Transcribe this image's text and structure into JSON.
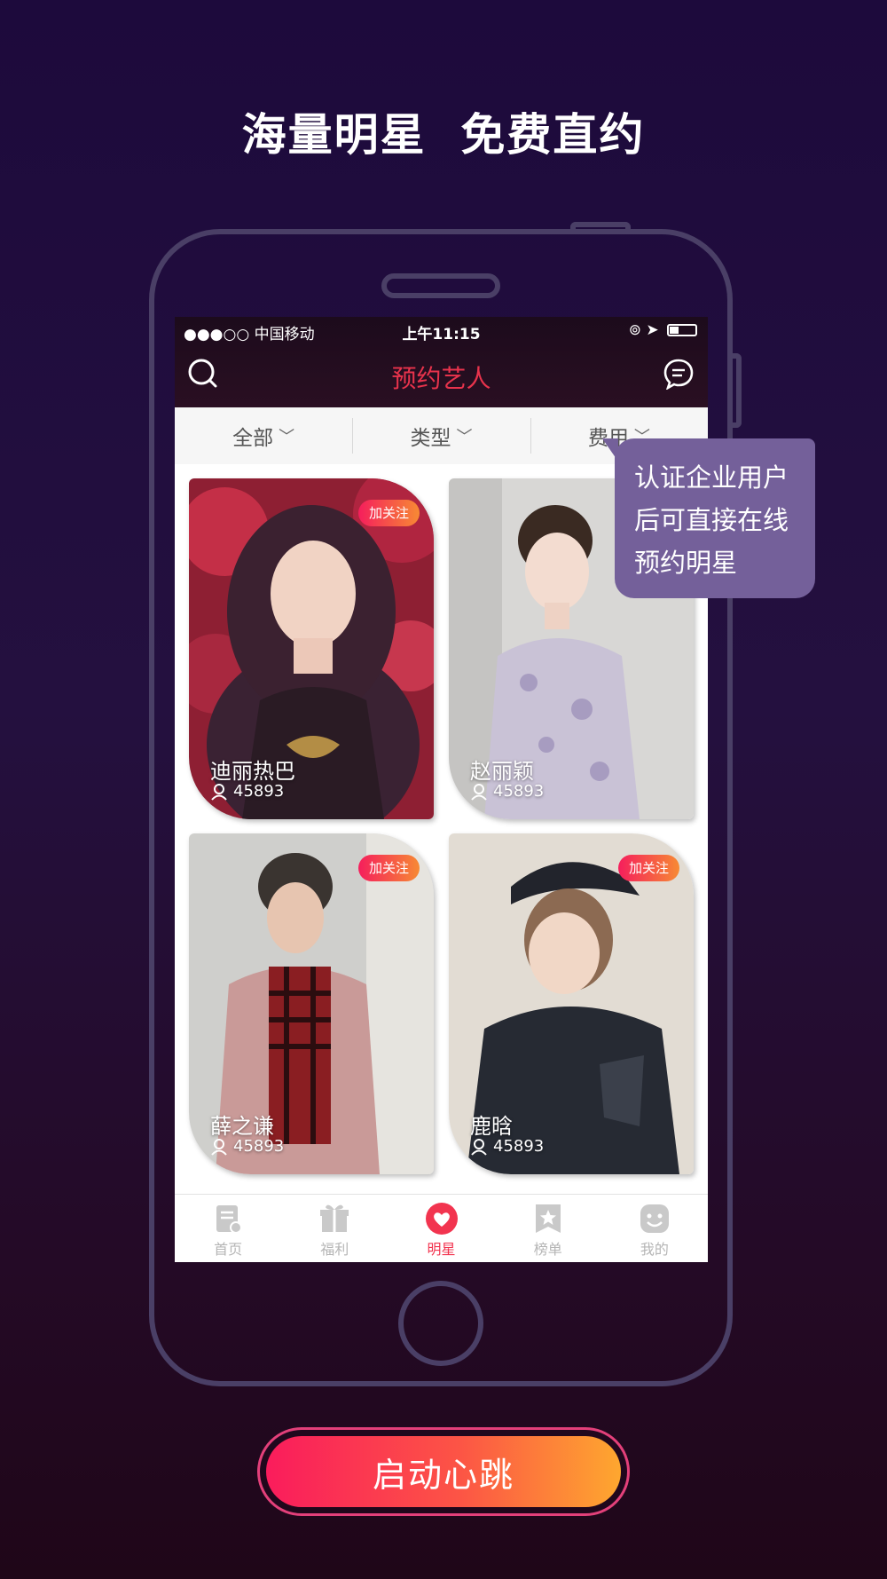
{
  "headline": "海量明星  免费直约",
  "status_bar": {
    "carrier": "●●●○○ 中国移动",
    "time": "上午11:15"
  },
  "nav": {
    "title": "预约艺人",
    "search_icon": "search-icon",
    "message_icon": "message-icon"
  },
  "filters": [
    {
      "label": "全部"
    },
    {
      "label": "类型"
    },
    {
      "label": "费用"
    }
  ],
  "cards": [
    {
      "name": "迪丽热巴",
      "fans": "45893",
      "follow_label": "加关注"
    },
    {
      "name": "赵丽颖",
      "fans": "45893",
      "follow_label": ""
    },
    {
      "name": "薛之谦",
      "fans": "45893",
      "follow_label": "加关注"
    },
    {
      "name": "鹿晗",
      "fans": "45893",
      "follow_label": "加关注"
    }
  ],
  "tabs": [
    {
      "label": "首页",
      "icon": "home-icon",
      "active": false
    },
    {
      "label": "福利",
      "icon": "gift-icon",
      "active": false
    },
    {
      "label": "明星",
      "icon": "heart-icon",
      "active": true
    },
    {
      "label": "榜单",
      "icon": "ranking-icon",
      "active": false
    },
    {
      "label": "我的",
      "icon": "profile-icon",
      "active": false
    }
  ],
  "tooltip": {
    "line1": "认证企业用户",
    "line2": "后可直接在线",
    "line3": "预约明星"
  },
  "cta_label": "启动心跳",
  "colors": {
    "accent": "#e8334c",
    "tooltip": "#74609a",
    "cta_start": "#fa1c5c",
    "cta_end": "#fea72f"
  }
}
